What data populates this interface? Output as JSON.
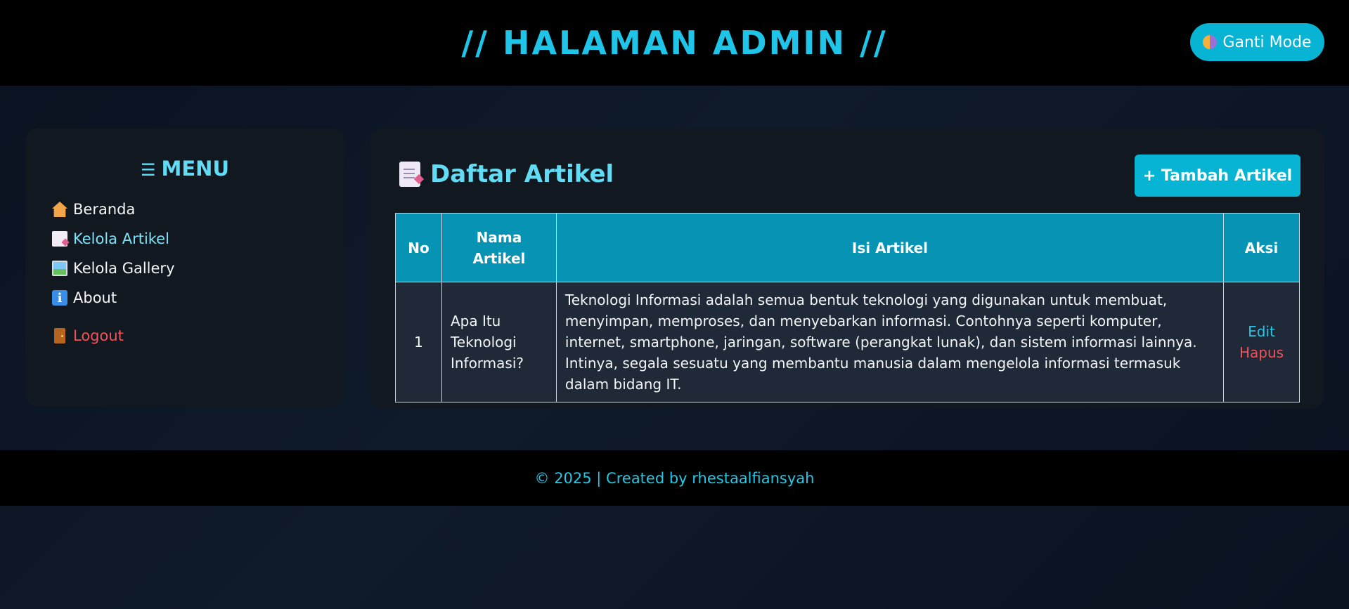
{
  "header": {
    "title": "// HALAMAN ADMIN //",
    "mode_button_label": "Ganti Mode"
  },
  "sidebar": {
    "title": "MENU",
    "title_icon": "☰",
    "items": [
      {
        "label": "Beranda",
        "icon": "house-icon"
      },
      {
        "label": "Kelola Artikel",
        "icon": "document-icon",
        "active": true
      },
      {
        "label": "Kelola Gallery",
        "icon": "picture-icon"
      },
      {
        "label": "About",
        "icon": "info-icon"
      }
    ],
    "logout_label": "Logout"
  },
  "main": {
    "title": "Daftar Artikel",
    "add_button_label": "+ Tambah Artikel",
    "table": {
      "headers": [
        "No",
        "Nama Artikel",
        "Isi Artikel",
        "Aksi"
      ],
      "rows": [
        {
          "no": "1",
          "name": "Apa Itu Teknologi Informasi?",
          "content": "Teknologi Informasi adalah semua bentuk teknologi yang digunakan untuk membuat, menyimpan, memproses, dan menyebarkan informasi. Contohnya seperti komputer, internet, smartphone, jaringan, software (perangkat lunak), dan sistem informasi lainnya. Intinya, segala sesuatu yang membantu manusia dalam mengelola informasi termasuk dalam bidang IT.",
          "edit_label": "Edit",
          "delete_label": "Hapus"
        }
      ]
    }
  },
  "footer": {
    "text": "© 2025 | Created by rhestaalfiansyah"
  },
  "colors": {
    "accent": "#08b4d4",
    "title_cyan": "#1fc5e8",
    "danger": "#f0535b",
    "table_header": "#0793b3"
  }
}
